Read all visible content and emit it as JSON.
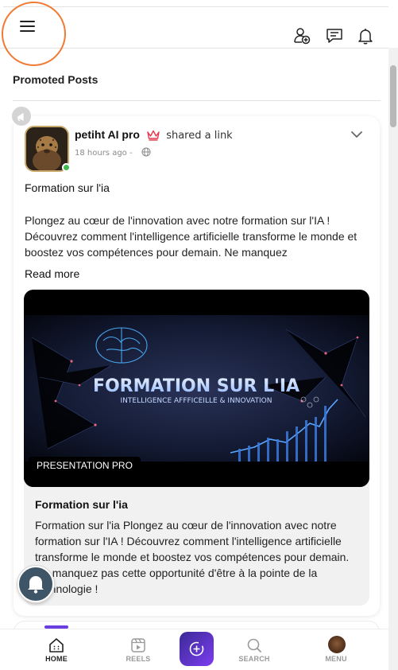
{
  "header": {
    "menu_icon": "hamburger-icon",
    "actions": [
      {
        "name": "add-friend",
        "icon": "user-plus-icon"
      },
      {
        "name": "messages",
        "icon": "chat-icon"
      },
      {
        "name": "notifications",
        "icon": "bell-icon"
      }
    ]
  },
  "section": {
    "title": "Promoted Posts"
  },
  "post": {
    "author": "petiht AI pro",
    "action": "shared a link",
    "time": "18 hours ago -",
    "title": "Formation sur l'ia",
    "body": "Plongez au cœur de l'innovation avec notre formation sur l'IA ! Découvrez comment l'intelligence artificielle transforme le monde et boostez vos compétences pour demain. Ne manquez",
    "read_more": "Read more",
    "link": {
      "image_title": "FORMATION SUR L'IA",
      "image_subtitle": "INTELLIGENCE AFFFICEILLE & INNOVATION",
      "tag": "PRESENTATION PRO",
      "title": "Formation sur l'ia",
      "description": "Formation sur l'ia Plongez au cœur de l'innovation avec notre formation sur l'IA ! Découvrez comment l'intelligence artificielle transforme le monde et boostez vos compétences pour demain. Ne manquez pas cette opportunité d'être à la pointe de la technologie !"
    }
  },
  "nav": {
    "home": "HOME",
    "reels": "REELS",
    "search": "SEARCH",
    "menu": "MENU"
  },
  "colors": {
    "accent": "#7c3df0",
    "highlight_ring": "#ef7a33",
    "online": "#3fb950",
    "crown": "#e5364b"
  }
}
